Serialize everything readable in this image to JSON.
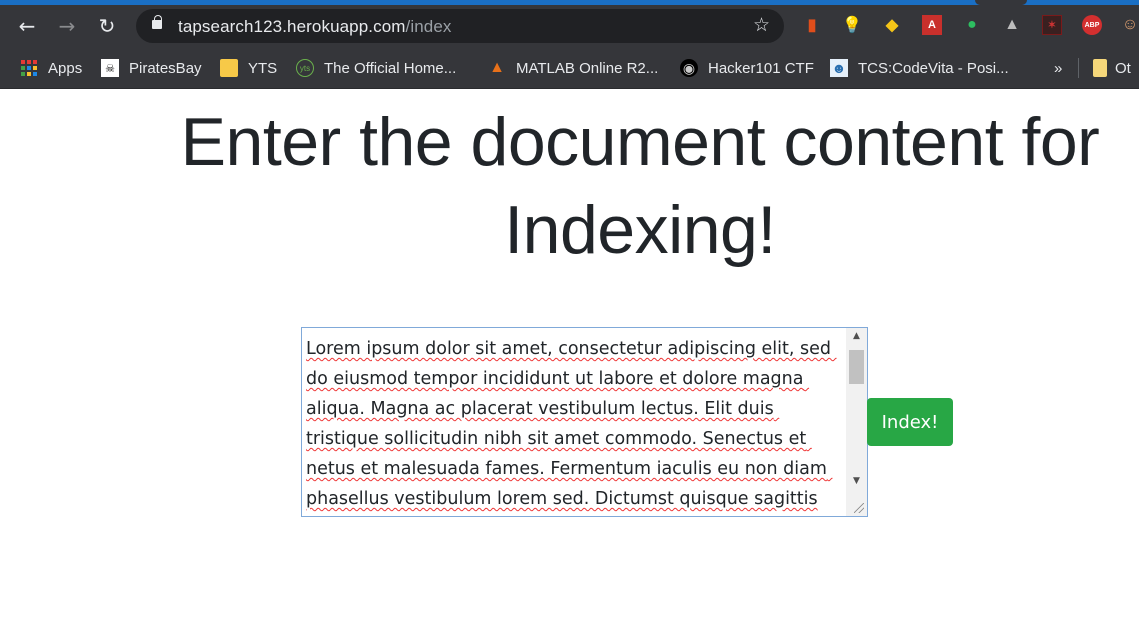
{
  "browser": {
    "url_host": "tapsearch123.herokuapp.com",
    "url_path": "/index",
    "nav": {
      "back": "←",
      "forward": "→",
      "reload": "↻"
    },
    "extensions": [
      {
        "name": "office-extension-icon",
        "glyph": "▮",
        "color": "#e04e1b"
      },
      {
        "name": "lightbulb-extension-icon",
        "glyph": "💡",
        "color": "#aaaaaa"
      },
      {
        "name": "python-extension-icon",
        "glyph": "◆",
        "color": "#f5c518"
      },
      {
        "name": "dictionary-extension-icon",
        "glyph": "A",
        "color": "#c9302c"
      },
      {
        "name": "evernote-extension-icon",
        "glyph": "●",
        "color": "#2dbe60"
      },
      {
        "name": "google-drive-extension-icon",
        "glyph": "▲",
        "color": "#bdbdbd"
      },
      {
        "name": "acrobat-extension-icon",
        "glyph": "✶",
        "color": "#7a1a1a"
      },
      {
        "name": "adblock-plus-extension-icon",
        "glyph": "ABP",
        "color": "#d32f2f"
      },
      {
        "name": "avatar-extension-icon",
        "glyph": "☺",
        "color": "#e0a070"
      }
    ],
    "bookmarks": [
      {
        "label": "Apps",
        "icon": "apps-grid-icon"
      },
      {
        "label": "PiratesBay",
        "icon": "pirate-icon",
        "glyph": "☠"
      },
      {
        "label": "YTS",
        "icon": "yts-icon",
        "glyph": "▰"
      },
      {
        "label": "The Official Home...",
        "icon": "yts-logo-icon",
        "glyph": "yts"
      },
      {
        "label": "MATLAB Online R2...",
        "icon": "matlab-icon",
        "glyph": "▲"
      },
      {
        "label": "Hacker101 CTF",
        "icon": "hacker101-icon",
        "glyph": "◉"
      },
      {
        "label": "TCS:CodeVita - Posi...",
        "icon": "codevita-icon",
        "glyph": "☻"
      }
    ],
    "overflow": "»",
    "other_bookmarks": "Ot"
  },
  "page": {
    "heading": "Enter the document content for Indexing!",
    "textarea_value": "Lorem ipsum dolor sit amet, consectetur adipiscing elit, sed do eiusmod tempor incididunt ut labore et dolore magna aliqua. Magna ac placerat vestibulum lectus. Elit duis tristique sollicitudin nibh sit amet commodo. Senectus et netus et malesuada fames. Fermentum iaculis eu non diam phasellus vestibulum lorem sed. Dictumst quisque sagittis",
    "submit_label": "Index!",
    "accent_color": "#28a745"
  }
}
